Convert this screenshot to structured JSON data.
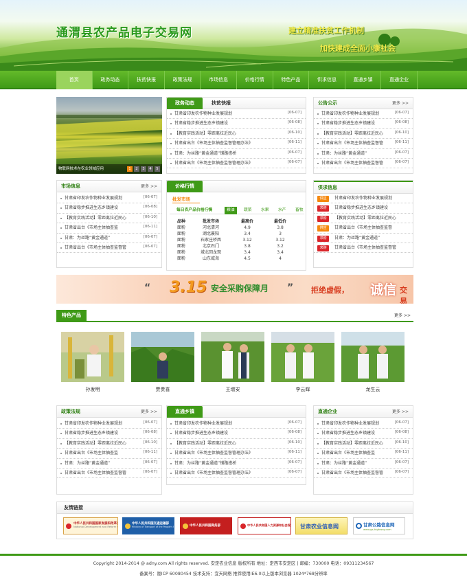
{
  "header": {
    "site_title": "通渭县农产品电子交易网",
    "slogan1": "建立精准扶贫工作机制",
    "slogan2": "加快建成全面小康社会"
  },
  "nav": [
    "首页",
    "政务动态",
    "扶贫快报",
    "政策法规",
    "市场信息",
    "价格行情",
    "特色产品",
    "供求信息",
    "直通乡镇",
    "直通企业"
  ],
  "colors": {
    "green": "#3f9a17",
    "orange": "#f5880e",
    "red": "#d9252a"
  },
  "slide": {
    "caption": "物联网技术在农业领域应用",
    "pages": [
      "1",
      "2",
      "3",
      "4",
      "5"
    ]
  },
  "news": {
    "tabs": [
      "政务动态",
      "扶贫快报"
    ],
    "items": [
      {
        "t": "甘肃省印发农作物种业发展规划",
        "d": "[06-07]"
      },
      {
        "t": "甘肃省稳步推进生态乡镇建设",
        "d": "[06-08]"
      },
      {
        "t": "【教育实践活动】零距离拉近民心",
        "d": "[06-10]"
      },
      {
        "t": "甘肃省出台《市场主体抽查监督管理办法》",
        "d": "[06-11]"
      },
      {
        "t": "甘肃：为丝路“黄金通道”铺路搭桥",
        "d": "[06-07]"
      },
      {
        "t": "甘肃省出台《市场主体抽查监督管理办法》",
        "d": "[06-07]"
      }
    ]
  },
  "notice": {
    "title": "公告公示",
    "more": "更多 >>",
    "items": [
      {
        "t": "甘肃省印发农作物种业发展规划",
        "d": "[06-07]"
      },
      {
        "t": "甘肃省稳步推进生态乡镇建设",
        "d": "[06-08]"
      },
      {
        "t": "【教育实践活动】零距离拉近民心",
        "d": "[06-10]"
      },
      {
        "t": "甘肃省出台《市场主体抽查监督管",
        "d": "[06-11]"
      },
      {
        "t": "甘肃：为丝路“黄金通道”",
        "d": "[06-07]"
      },
      {
        "t": "甘肃省出台《市场主体抽查监督管",
        "d": "[06-07]"
      }
    ]
  },
  "market": {
    "title": "市场信息",
    "more": "更多 >>",
    "items": [
      {
        "t": "甘肃省印发农作物种业发展规划",
        "d": "[06-07]"
      },
      {
        "t": "甘肃省稳步推进生态乡镇建设",
        "d": "[06-08]"
      },
      {
        "t": "【教育实践活动】零距离拉近民心",
        "d": "[06-10]"
      },
      {
        "t": "甘肃省出台《市场主体抽查监",
        "d": "[06-11]"
      },
      {
        "t": "甘肃：为丝路“黄金通道”",
        "d": "[06-07]"
      },
      {
        "t": "甘肃省出台《市场主体抽查监督管",
        "d": "[06-07]"
      }
    ]
  },
  "price": {
    "title": "价格行情",
    "sub": "批发市场",
    "daily": "每日农产品价格行情",
    "cats": [
      "粮油",
      "蔬菜",
      "水果",
      "水产",
      "畜牧"
    ],
    "headers": [
      "品种",
      "批发市场",
      "最高价",
      "最低价"
    ],
    "rows": [
      [
        "面粉",
        "河北清河",
        "4.9",
        "3.8"
      ],
      [
        "面粉",
        "湖北襄阳",
        "3.4",
        "3"
      ],
      [
        "面粉",
        "石家庄桥西",
        "3.12",
        "3.12"
      ],
      [
        "面粉",
        "北京石门",
        "3.8",
        "3.2"
      ],
      [
        "面粉",
        "城北回龙观",
        "3.4",
        "3.4"
      ],
      [
        "面粉",
        "山东威海",
        "4.5",
        "4"
      ]
    ]
  },
  "supply": {
    "title": "供求信息",
    "tag_gong": "供应",
    "tag_qiu": "求购",
    "items": [
      {
        "tag": "供应",
        "t": "甘肃省印发农作物种业发展规划"
      },
      {
        "tag": "求购",
        "t": "甘肃省稳步推进生态乡镇建设"
      },
      {
        "tag": "求购",
        "t": "【教育实践活动】零距离拉近民心"
      },
      {
        "tag": "供应",
        "t": "甘肃省出台《市场主体抽查监督"
      },
      {
        "tag": "求购",
        "t": "甘肃：为丝路“黄金通道”"
      },
      {
        "tag": "求购",
        "t": "甘肃省出台《市场主体抽查监督管"
      }
    ]
  },
  "ad": {
    "q1": "“",
    "big": "3.15",
    "q2": "安全采购保障月",
    "q3": "”",
    "p1": "拒绝虚假，",
    "cheng": "诚信",
    "p2": "交易"
  },
  "products": {
    "title": "特色产品",
    "more": "更多 >>",
    "names": [
      "孙发明",
      "贾贵喜",
      "王增安",
      "李云辉",
      "龙生云"
    ]
  },
  "policy": {
    "title": "政策法规",
    "more": "更多 >>",
    "items": [
      {
        "t": "甘肃省印发农作物种业发展规划",
        "d": "[06-07]"
      },
      {
        "t": "甘肃省稳步推进生态乡镇建设",
        "d": "[06-08]"
      },
      {
        "t": "【教育实践活动】零距离拉近民心",
        "d": "[06-10]"
      },
      {
        "t": "甘肃省出台《市场主体抽查监",
        "d": "[06-11]"
      },
      {
        "t": "甘肃：为丝路“黄金通道”",
        "d": "[06-07]"
      },
      {
        "t": "甘肃省出台《市场主体抽查监督管",
        "d": "[06-07]"
      }
    ]
  },
  "towns": {
    "title": "直通乡镇",
    "items": [
      {
        "t": "甘肃省印发农作物种业发展规划",
        "d": "[06-07]"
      },
      {
        "t": "甘肃省稳步推进生态乡镇建设",
        "d": "[06-08]"
      },
      {
        "t": "【教育实践活动】零距离拉近民心",
        "d": "[06-10]"
      },
      {
        "t": "甘肃省出台《市场主体抽查监督管理办法》",
        "d": "[06-11]"
      },
      {
        "t": "甘肃：为丝路“黄金通道”铺路搭桥",
        "d": "[06-07]"
      },
      {
        "t": "甘肃省出台《市场主体抽查监督管理办法》",
        "d": "[06-07]"
      }
    ]
  },
  "companies": {
    "title": "直通企业",
    "more": "更多 >>",
    "items": [
      {
        "t": "甘肃省印发农作物种业发展规划",
        "d": "[06-07]"
      },
      {
        "t": "甘肃省稳步推进生态乡镇建设",
        "d": "[06-08]"
      },
      {
        "t": "【教育实践活动】零距离拉近民心",
        "d": "[06-10]"
      },
      {
        "t": "甘肃省出台《市场主体抽查监",
        "d": "[06-11]"
      },
      {
        "t": "甘肃：为丝路“黄金通道”",
        "d": "[06-07]"
      },
      {
        "t": "甘肃省出台《市场主体抽查监督管",
        "d": "[06-07]"
      }
    ]
  },
  "links": {
    "title": "友情链接",
    "items": [
      "中华人民共和国国家发展和改革委员会",
      "中华人民共和国交通运输部",
      "中华人民共和国商务部",
      "中华人民共和国人力资源和社会保障部",
      "甘肃农业信息网",
      "甘肃公路信息网"
    ],
    "sub": [
      "National Development and Reform Commission",
      "Ministry of Transport of the People's Republic of China",
      "",
      "",
      "",
      "www.gs-highway.com"
    ]
  },
  "footer": {
    "line1": "Copyright 2014-2014 @ adny.com All rights reserved. 安定农业信息 版权所有    地址：定西市安定区 | 邮编：730000 电话：09311234567",
    "line2": "备案号：陇ICP 60080454   技术支持：宜天网络    推荐使用IE6.0以上版本浏览器  1024*768分辨率"
  }
}
